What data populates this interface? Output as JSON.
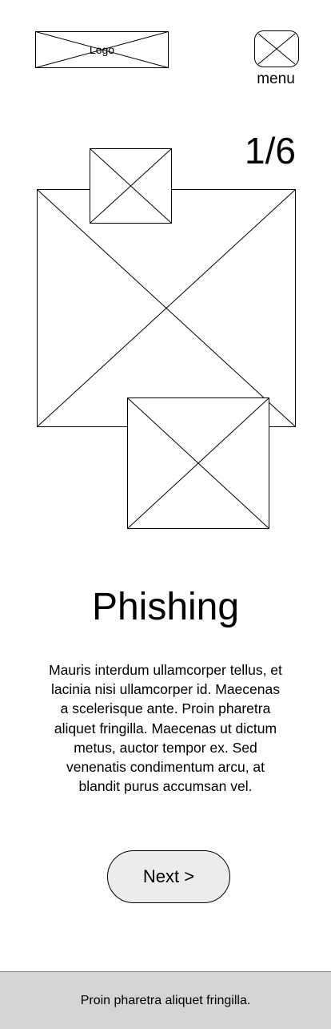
{
  "header": {
    "logo_label": "Logo",
    "menu_label": "menu"
  },
  "slide": {
    "counter": "1/6",
    "title": "Phishing",
    "body": "Mauris interdum ullamcorper tellus, et lacinia nisi ullamcorper id. Maecenas a scelerisque ante. Proin pharetra aliquet fringilla. Maecenas ut dictum metus, auctor tempor ex. Sed venenatis condimentum arcu, at blandit purus accumsan vel.",
    "next_label": "Next >"
  },
  "footer": {
    "text": "Proin pharetra aliquet fringilla."
  },
  "colors": {
    "button_fill": "#ececec",
    "footer_fill": "#d4d4d4",
    "stroke": "#000000"
  }
}
